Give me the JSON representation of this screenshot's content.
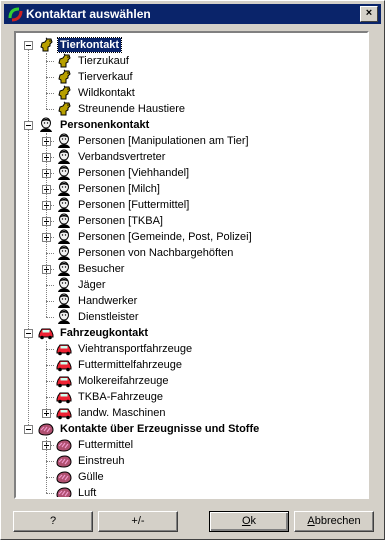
{
  "window": {
    "title": "Kontaktart auswählen",
    "close_glyph": "×"
  },
  "tree": [
    {
      "label": "Tierkontakt",
      "icon": "animal-icon",
      "selected": true,
      "children": [
        {
          "label": "Tierzukauf",
          "icon": "animal-icon"
        },
        {
          "label": "Tierverkauf",
          "icon": "animal-icon"
        },
        {
          "label": "Wildkontakt",
          "icon": "animal-icon"
        },
        {
          "label": "Streunende Haustiere",
          "icon": "animal-icon"
        }
      ]
    },
    {
      "label": "Personenkontakt",
      "icon": "person-icon",
      "children": [
        {
          "label": "Personen [Manipulationen am Tier]",
          "icon": "person-icon",
          "expandable": true
        },
        {
          "label": "Verbandsvertreter",
          "icon": "person-icon",
          "expandable": true
        },
        {
          "label": "Personen [Viehhandel]",
          "icon": "person-icon",
          "expandable": true
        },
        {
          "label": "Personen [Milch]",
          "icon": "person-icon",
          "expandable": true
        },
        {
          "label": "Personen [Futtermittel]",
          "icon": "person-icon",
          "expandable": true
        },
        {
          "label": "Personen [TKBA]",
          "icon": "person-icon",
          "expandable": true
        },
        {
          "label": "Personen [Gemeinde, Post, Polizei]",
          "icon": "person-icon",
          "expandable": true
        },
        {
          "label": "Personen von Nachbargehöften",
          "icon": "person-icon"
        },
        {
          "label": "Besucher",
          "icon": "person-icon",
          "expandable": true
        },
        {
          "label": "Jäger",
          "icon": "person-icon"
        },
        {
          "label": "Handwerker",
          "icon": "person-icon"
        },
        {
          "label": "Dienstleister",
          "icon": "person-icon"
        }
      ]
    },
    {
      "label": "Fahrzeugkontakt",
      "icon": "car-icon",
      "children": [
        {
          "label": "Viehtransportfahrzeuge",
          "icon": "car-icon"
        },
        {
          "label": "Futtermittelfahrzeuge",
          "icon": "car-icon"
        },
        {
          "label": "Molkereifahrzeuge",
          "icon": "car-icon"
        },
        {
          "label": "TKBA-Fahrzeuge",
          "icon": "car-icon"
        },
        {
          "label": "landw. Maschinen",
          "icon": "car-icon",
          "expandable": true
        }
      ]
    },
    {
      "label": "Kontakte über Erzeugnisse und Stoffe",
      "icon": "material-icon",
      "children": [
        {
          "label": "Futtermittel",
          "icon": "material-icon",
          "expandable": true
        },
        {
          "label": "Einstreuh",
          "icon": "material-icon"
        },
        {
          "label": "Gülle",
          "icon": "material-icon"
        },
        {
          "label": "Luft",
          "icon": "material-icon"
        }
      ]
    }
  ],
  "buttons": {
    "help": "?",
    "toggle": "+/-",
    "ok_mnemonic": "O",
    "ok_rest": "k",
    "cancel_mnemonic": "A",
    "cancel_rest": "bbrechen"
  },
  "colors": {
    "titlebar": "#0a246a",
    "face": "#d4d0c8",
    "selection": "#0a246a"
  }
}
